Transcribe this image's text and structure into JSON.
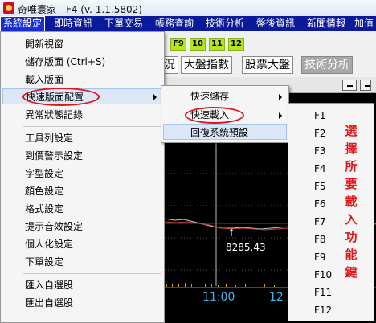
{
  "window": {
    "title": "奇唯寰家 - F4   (v. 1.1.5802)"
  },
  "menubar": [
    "系統設定",
    "即時資訊",
    "下單交易",
    "帳務查詢",
    "技術分析",
    "盤後資訊",
    "新聞情報",
    "加值"
  ],
  "function_keys": [
    "F9",
    "10",
    "11",
    "12"
  ],
  "tabs": [
    "況",
    "大盤指數",
    "股票大盤",
    "技術分析"
  ],
  "system_menu": {
    "items": [
      "開新視窗",
      "儲存版面 (Ctrl+S)",
      "載入版面",
      "快速版面配置",
      "異常狀態記錄",
      "工具列設定",
      "到價警示設定",
      "字型設定",
      "顏色設定",
      "格式設定",
      "提示音效設定",
      "個人化設定",
      "下單設定",
      "匯入自選股",
      "匯出自選股"
    ],
    "highlighted": "快速版面配置"
  },
  "quick_layout_submenu": {
    "items": [
      "快速儲存",
      "快速載入",
      "回復系統預設"
    ],
    "highlighted": "回復系統預設"
  },
  "quick_load_submenu": {
    "items": [
      "F1",
      "F2",
      "F3",
      "F4",
      "F5",
      "F6",
      "F7",
      "F8",
      "F9",
      "F10",
      "F11",
      "F12"
    ]
  },
  "chart": {
    "price_label": "8285.43",
    "time_labels": [
      "11:00",
      "12"
    ],
    "up_marker": "↑"
  },
  "annotation": {
    "text": [
      "選",
      "擇",
      "所",
      "要",
      "載",
      "入",
      "功",
      "能",
      "鍵"
    ]
  },
  "colors": {
    "menubar": "#0a1a9a",
    "accent_red": "#e0151b",
    "fkey_green": "#b5e61d"
  }
}
